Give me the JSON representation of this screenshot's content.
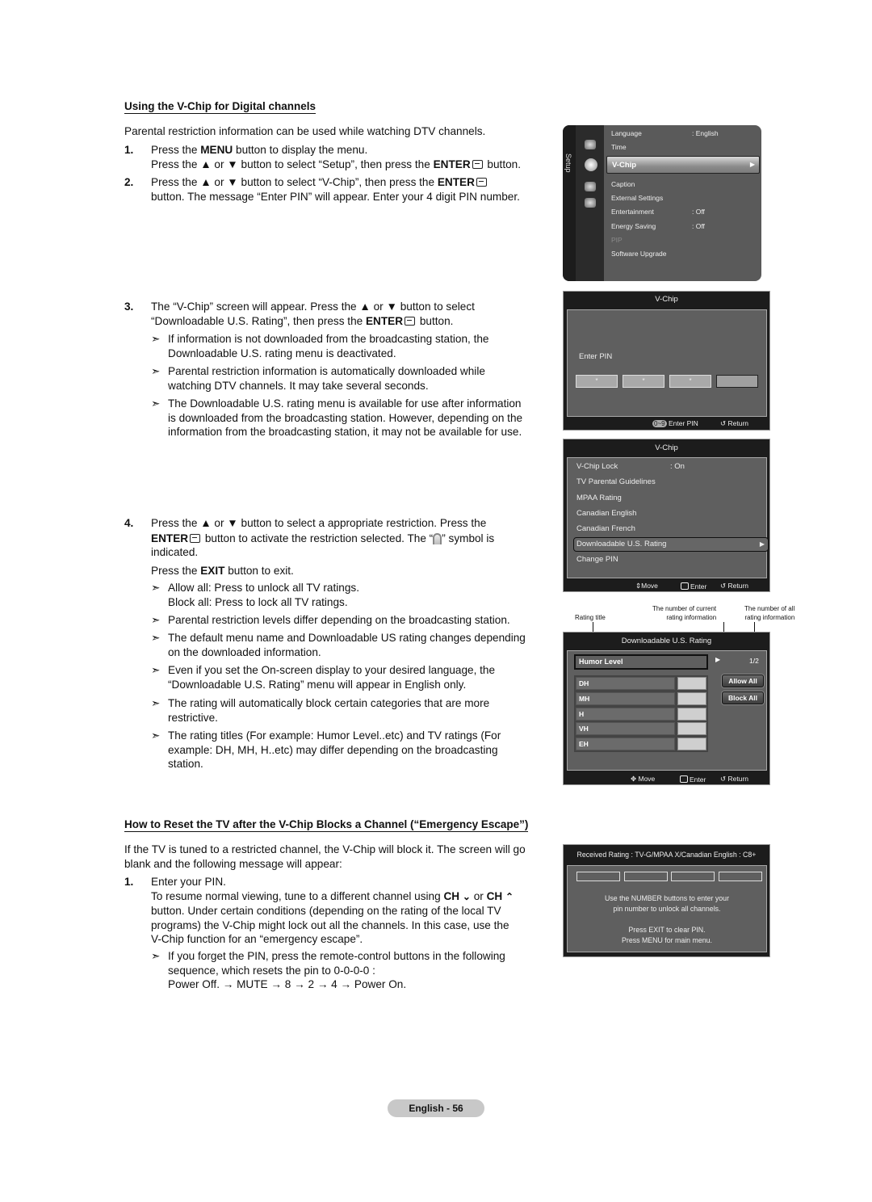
{
  "section1": {
    "heading": "Using the V-Chip for Digital channels",
    "intro": "Parental restriction information can be used while watching DTV channels.",
    "step1": {
      "num": "1.",
      "line1_pre": "Press the ",
      "line1_bold": "MENU",
      "line1_post": " button to display the menu.",
      "line2_pre": "Press the ▲ or ▼ button to select “Setup”, then press the ",
      "line2_bold": "ENTER",
      "line2_post": " button."
    },
    "step2": {
      "num": "2.",
      "line1_pre": "Press the ▲ or ▼ button to select “V-Chip”, then press the ",
      "line1_bold": "ENTER",
      "line2": "button. The message “Enter PIN” will appear. Enter your 4 digit PIN number."
    },
    "step3": {
      "num": "3.",
      "line1": "The “V-Chip” screen will appear. Press the ▲ or ▼ button to select",
      "line2_pre": "“Downloadable U.S. Rating”, then press the ",
      "line2_bold": "ENTER",
      "line2_post": " button.",
      "notes": [
        [
          "If information is not downloaded from the broadcasting station, the",
          "Downloadable U.S. rating menu is deactivated."
        ],
        [
          "Parental restriction information is automatically downloaded while",
          "watching DTV channels. It may take several seconds."
        ],
        [
          "The Downloadable U.S. rating menu is available for use after information",
          "is downloaded from the broadcasting station. However, depending on the",
          "information from the broadcasting station, it may not be available for use."
        ]
      ]
    },
    "step4": {
      "num": "4.",
      "line1": "Press the ▲ or ▼ button to select a appropriate restriction. Press the",
      "line2_bold": "ENTER",
      "line2_mid": " button to activate the restriction selected. The “",
      "line2_post": "” symbol is",
      "line3": "indicated.",
      "exit_pre": "Press the ",
      "exit_bold": "EXIT",
      "exit_post": " button to exit.",
      "notes": [
        [
          "Allow all: Press to unlock all TV ratings.",
          "Block all: Press to lock all TV ratings."
        ],
        [
          "Parental restriction levels differ depending on the broadcasting station."
        ],
        [
          "The default menu name and Downloadable US rating changes depending",
          "on the downloaded information."
        ],
        [
          "Even if you set the On-screen display to your desired language, the",
          "“Downloadable U.S. Rating” menu will appear in English only."
        ],
        [
          "The rating will automatically block certain categories that are more",
          "restrictive."
        ],
        [
          "The rating titles (For example: Humor Level..etc) and TV ratings (For",
          "example: DH, MH, H..etc) may differ depending on the broadcasting",
          "station."
        ]
      ]
    }
  },
  "section2": {
    "heading": "How to Reset the TV after the V-Chip Blocks a Channel (“Emergency Escape”)",
    "intro": [
      "If the TV is tuned to a restricted channel, the V-Chip will block it. The screen will go",
      "blank and the following message will appear:"
    ],
    "step1": {
      "num": "1.",
      "line1": "Enter your PIN.",
      "line2_pre": "To resume normal viewing, tune to a different channel using ",
      "ch": "CH",
      "or": " or ",
      "line3": "button. Under certain conditions (depending on the rating of the local TV",
      "line4": "programs) the V-Chip might lock out all the channels. In this case, use the",
      "line5": "V-Chip function for an “emergency escape”."
    },
    "note": [
      "If you forget the PIN, press the remote-control buttons in the following",
      "sequence, which resets the pin to 0-0-0-0 :",
      "Power Off. → MUTE → 8 → 2 → 4 → Power On."
    ]
  },
  "note_arrow": "➣",
  "setup_menu": {
    "tab_label": "Setup",
    "items": [
      {
        "label": "Language",
        "value": ": English"
      },
      {
        "label": "Time",
        "value": ""
      },
      {
        "label": "V-Chip",
        "value": "",
        "selected": true
      },
      {
        "label": "Caption",
        "value": ""
      },
      {
        "label": "External Settings",
        "value": ""
      },
      {
        "label": "Entertainment",
        "value": ": Off"
      },
      {
        "label": "Energy Saving",
        "value": ": Off"
      },
      {
        "label": "PIP",
        "value": "",
        "disabled": true
      },
      {
        "label": "Software Upgrade",
        "value": ""
      }
    ],
    "icons": [
      "picture-icon",
      "setup-gear-icon",
      "input-icon",
      "application-icon"
    ]
  },
  "pin_screen": {
    "title": "V-Chip",
    "label": "Enter PIN",
    "digits": [
      "*",
      "*",
      "*",
      ""
    ],
    "footer": {
      "key": "0~9",
      "enter": "Enter PIN",
      "return": "Return"
    }
  },
  "vchip_menu": {
    "title": "V-Chip",
    "items": [
      {
        "label": "V-Chip Lock",
        "value": ": On"
      },
      {
        "label": "TV Parental Guidelines",
        "value": ""
      },
      {
        "label": "MPAA Rating",
        "value": ""
      },
      {
        "label": "Canadian English",
        "value": ""
      },
      {
        "label": "Canadian French",
        "value": ""
      },
      {
        "label": "Downloadable U.S. Rating",
        "value": "",
        "selected": true
      },
      {
        "label": "Change PIN",
        "value": ""
      }
    ],
    "footer": {
      "move": "Move",
      "enter": "Enter",
      "return": "Return"
    }
  },
  "rating_screen": {
    "callouts": {
      "title": "Rating title",
      "current": [
        "The number of current",
        "rating information"
      ],
      "all": [
        "The number of all",
        "rating information"
      ]
    },
    "title": "Downloadable U.S. Rating",
    "rating_title": "Humor Level",
    "page": "1/2",
    "ratings": [
      "DH",
      "MH",
      "H",
      "VH",
      "EH"
    ],
    "allow_all": "Allow All",
    "block_all": "Block All",
    "footer": {
      "move": "Move",
      "enter": "Enter",
      "return": "Return"
    }
  },
  "block_screen": {
    "title": "Received Rating : TV-G/MPAA X/Canadian English : C8+",
    "msg1": [
      "Use the NUMBER buttons to enter your",
      "pin number to unlock all channels."
    ],
    "msg2": [
      "Press EXIT to clear PIN.",
      "Press MENU for main menu."
    ]
  },
  "page_footer": "English - 56"
}
